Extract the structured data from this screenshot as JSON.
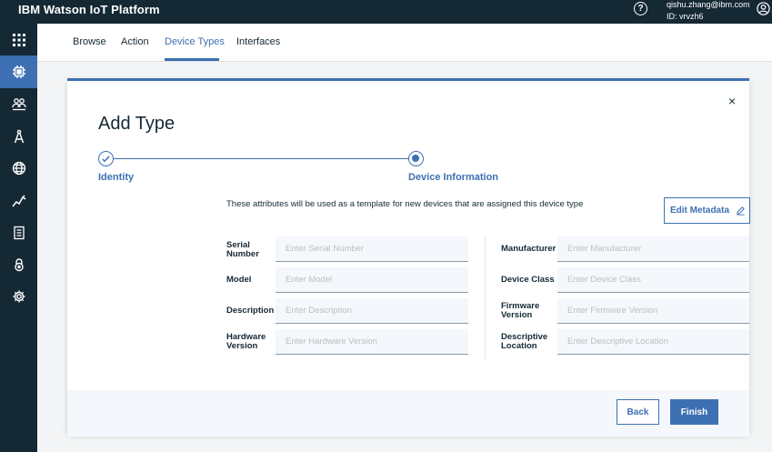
{
  "header": {
    "brand": "IBM Watson IoT Platform",
    "help_glyph": "?",
    "user_email": "qishu.zhang@ibm.com",
    "user_id": "ID: vrvzh6"
  },
  "sidebar": {
    "items": [
      {
        "icon": "apps-grid-icon",
        "active": false
      },
      {
        "icon": "chip-icon",
        "active": true
      },
      {
        "icon": "members-icon",
        "active": false
      },
      {
        "icon": "compass-icon",
        "active": false
      },
      {
        "icon": "globe-icon",
        "active": false
      },
      {
        "icon": "analytics-icon",
        "active": false
      },
      {
        "icon": "document-icon",
        "active": false
      },
      {
        "icon": "lock-icon",
        "active": false
      },
      {
        "icon": "gear-icon",
        "active": false
      }
    ]
  },
  "tabs": [
    {
      "label": "Browse",
      "active": false
    },
    {
      "label": "Action",
      "active": false
    },
    {
      "label": "Device Types",
      "active": true
    },
    {
      "label": "Interfaces",
      "active": false
    }
  ],
  "modal": {
    "title": "Add Type",
    "close_glyph": "×",
    "steps": [
      {
        "label": "Identity",
        "status": "complete"
      },
      {
        "label": "Device Information",
        "status": "current"
      }
    ],
    "info_text": "These attributes will be used as a template for new devices that are assigned this device type",
    "edit_metadata_label": "Edit Metadata",
    "fields_left": [
      {
        "label": "Serial Number",
        "placeholder": "Enter Serial Number",
        "value": ""
      },
      {
        "label": "Model",
        "placeholder": "Enter Model",
        "value": ""
      },
      {
        "label": "Description",
        "placeholder": "Enter Description",
        "value": ""
      },
      {
        "label": "Hardware Version",
        "placeholder": "Enter Hardware Version",
        "value": ""
      }
    ],
    "fields_right": [
      {
        "label": "Manufacturer",
        "placeholder": "Enter Manufacturer",
        "value": ""
      },
      {
        "label": "Device Class",
        "placeholder": "Enter Device Class",
        "value": ""
      },
      {
        "label": "Firmware Version",
        "placeholder": "Enter Firmware Version",
        "value": ""
      },
      {
        "label": "Descriptive Location",
        "placeholder": "Enter Descriptive Location",
        "value": ""
      }
    ],
    "back_label": "Back",
    "finish_label": "Finish"
  },
  "colors": {
    "topbar": "#152935",
    "accent": "#3d70b2",
    "input_bg": "#f4f7fb"
  }
}
